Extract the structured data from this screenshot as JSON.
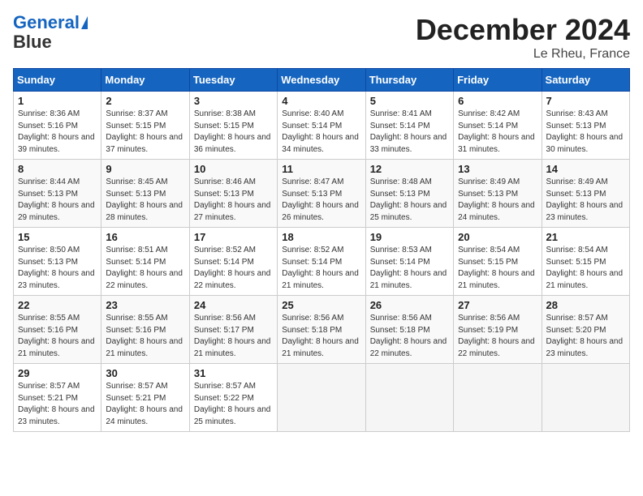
{
  "header": {
    "logo_line1": "General",
    "logo_line2": "Blue",
    "month_title": "December 2024",
    "location": "Le Rheu, France"
  },
  "days_of_week": [
    "Sunday",
    "Monday",
    "Tuesday",
    "Wednesday",
    "Thursday",
    "Friday",
    "Saturday"
  ],
  "weeks": [
    [
      {
        "day": 1,
        "sunrise": "8:36 AM",
        "sunset": "5:16 PM",
        "daylight": "8 hours and 39 minutes"
      },
      {
        "day": 2,
        "sunrise": "8:37 AM",
        "sunset": "5:15 PM",
        "daylight": "8 hours and 37 minutes"
      },
      {
        "day": 3,
        "sunrise": "8:38 AM",
        "sunset": "5:15 PM",
        "daylight": "8 hours and 36 minutes"
      },
      {
        "day": 4,
        "sunrise": "8:40 AM",
        "sunset": "5:14 PM",
        "daylight": "8 hours and 34 minutes"
      },
      {
        "day": 5,
        "sunrise": "8:41 AM",
        "sunset": "5:14 PM",
        "daylight": "8 hours and 33 minutes"
      },
      {
        "day": 6,
        "sunrise": "8:42 AM",
        "sunset": "5:14 PM",
        "daylight": "8 hours and 31 minutes"
      },
      {
        "day": 7,
        "sunrise": "8:43 AM",
        "sunset": "5:13 PM",
        "daylight": "8 hours and 30 minutes"
      }
    ],
    [
      {
        "day": 8,
        "sunrise": "8:44 AM",
        "sunset": "5:13 PM",
        "daylight": "8 hours and 29 minutes"
      },
      {
        "day": 9,
        "sunrise": "8:45 AM",
        "sunset": "5:13 PM",
        "daylight": "8 hours and 28 minutes"
      },
      {
        "day": 10,
        "sunrise": "8:46 AM",
        "sunset": "5:13 PM",
        "daylight": "8 hours and 27 minutes"
      },
      {
        "day": 11,
        "sunrise": "8:47 AM",
        "sunset": "5:13 PM",
        "daylight": "8 hours and 26 minutes"
      },
      {
        "day": 12,
        "sunrise": "8:48 AM",
        "sunset": "5:13 PM",
        "daylight": "8 hours and 25 minutes"
      },
      {
        "day": 13,
        "sunrise": "8:49 AM",
        "sunset": "5:13 PM",
        "daylight": "8 hours and 24 minutes"
      },
      {
        "day": 14,
        "sunrise": "8:49 AM",
        "sunset": "5:13 PM",
        "daylight": "8 hours and 23 minutes"
      }
    ],
    [
      {
        "day": 15,
        "sunrise": "8:50 AM",
        "sunset": "5:13 PM",
        "daylight": "8 hours and 23 minutes"
      },
      {
        "day": 16,
        "sunrise": "8:51 AM",
        "sunset": "5:14 PM",
        "daylight": "8 hours and 22 minutes"
      },
      {
        "day": 17,
        "sunrise": "8:52 AM",
        "sunset": "5:14 PM",
        "daylight": "8 hours and 22 minutes"
      },
      {
        "day": 18,
        "sunrise": "8:52 AM",
        "sunset": "5:14 PM",
        "daylight": "8 hours and 21 minutes"
      },
      {
        "day": 19,
        "sunrise": "8:53 AM",
        "sunset": "5:14 PM",
        "daylight": "8 hours and 21 minutes"
      },
      {
        "day": 20,
        "sunrise": "8:54 AM",
        "sunset": "5:15 PM",
        "daylight": "8 hours and 21 minutes"
      },
      {
        "day": 21,
        "sunrise": "8:54 AM",
        "sunset": "5:15 PM",
        "daylight": "8 hours and 21 minutes"
      }
    ],
    [
      {
        "day": 22,
        "sunrise": "8:55 AM",
        "sunset": "5:16 PM",
        "daylight": "8 hours and 21 minutes"
      },
      {
        "day": 23,
        "sunrise": "8:55 AM",
        "sunset": "5:16 PM",
        "daylight": "8 hours and 21 minutes"
      },
      {
        "day": 24,
        "sunrise": "8:56 AM",
        "sunset": "5:17 PM",
        "daylight": "8 hours and 21 minutes"
      },
      {
        "day": 25,
        "sunrise": "8:56 AM",
        "sunset": "5:18 PM",
        "daylight": "8 hours and 21 minutes"
      },
      {
        "day": 26,
        "sunrise": "8:56 AM",
        "sunset": "5:18 PM",
        "daylight": "8 hours and 22 minutes"
      },
      {
        "day": 27,
        "sunrise": "8:56 AM",
        "sunset": "5:19 PM",
        "daylight": "8 hours and 22 minutes"
      },
      {
        "day": 28,
        "sunrise": "8:57 AM",
        "sunset": "5:20 PM",
        "daylight": "8 hours and 23 minutes"
      }
    ],
    [
      {
        "day": 29,
        "sunrise": "8:57 AM",
        "sunset": "5:21 PM",
        "daylight": "8 hours and 23 minutes"
      },
      {
        "day": 30,
        "sunrise": "8:57 AM",
        "sunset": "5:21 PM",
        "daylight": "8 hours and 24 minutes"
      },
      {
        "day": 31,
        "sunrise": "8:57 AM",
        "sunset": "5:22 PM",
        "daylight": "8 hours and 25 minutes"
      },
      null,
      null,
      null,
      null
    ]
  ]
}
